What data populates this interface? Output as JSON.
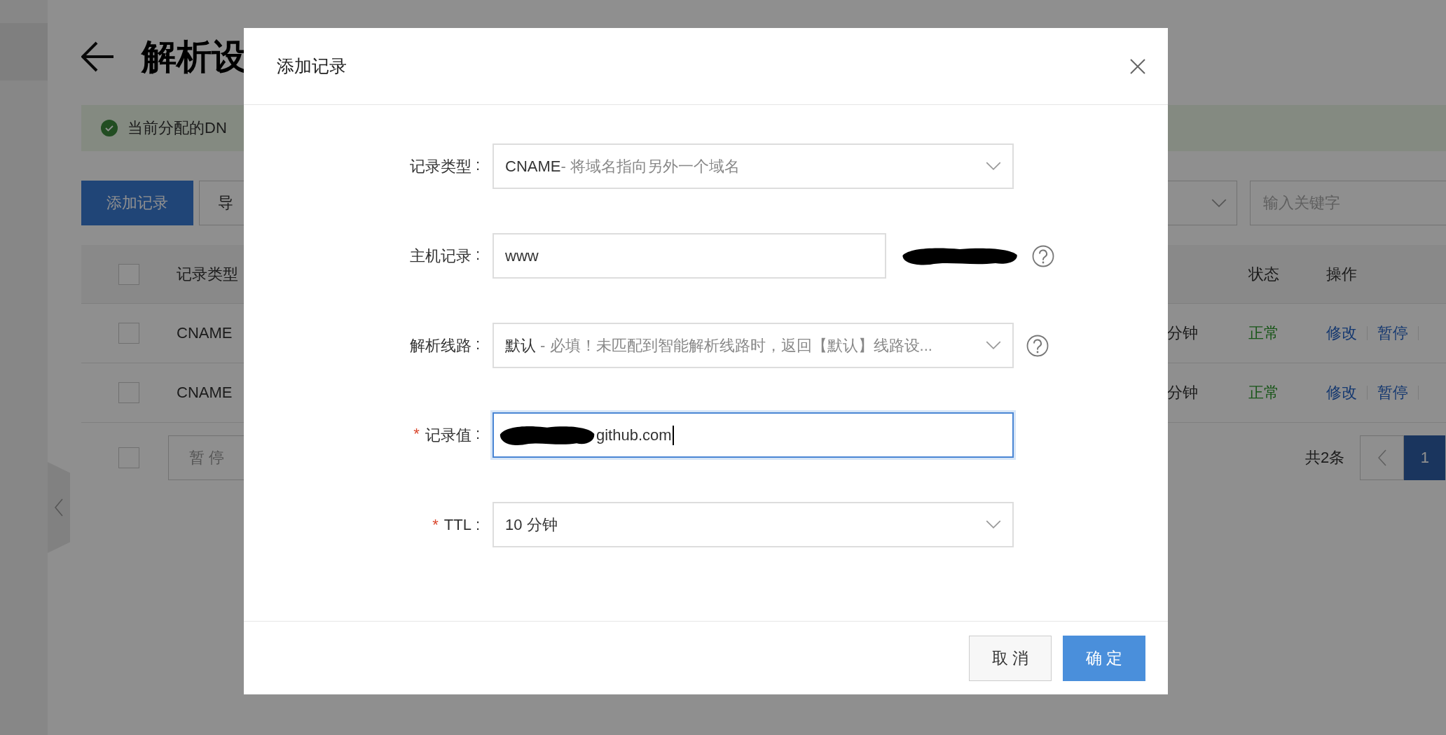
{
  "page": {
    "title": "解析设",
    "alert": "当前分配的DN",
    "toolbar": {
      "buttons": [
        {
          "label": "添加记录",
          "kind": "primary"
        },
        {
          "label": "导",
          "kind": "default"
        }
      ],
      "search": {
        "placeholder": "输入关键字"
      }
    },
    "table": {
      "header_checked": false,
      "columns": [
        {
          "label": "记录类型"
        },
        {
          "label": "状态"
        },
        {
          "label": "操作"
        }
      ],
      "rows": [
        {
          "checked": false,
          "type": "CNAME",
          "ttl": "分钟",
          "status": "正常",
          "actions": [
            "修改",
            "暂停"
          ]
        },
        {
          "checked": false,
          "type": "CNAME",
          "ttl": "分钟",
          "status": "正常",
          "actions": [
            "修改",
            "暂停"
          ]
        }
      ],
      "footer": {
        "checked": false,
        "bulk_button": "暂 停",
        "total": "共2条",
        "pages": [
          {
            "label": "1",
            "selected": true
          }
        ]
      }
    }
  },
  "dialog": {
    "title": "添加记录",
    "fields": [
      {
        "kind": "select",
        "label": "记录类型",
        "colon": ":",
        "value": "CNAME",
        "detail": "- 将域名指向另外一个域名"
      },
      {
        "kind": "text",
        "label": "主机记录",
        "colon": ":",
        "value": "www",
        "suffix_redacted": true,
        "help": true
      },
      {
        "kind": "select",
        "label": "解析线路",
        "colon": ":",
        "value": "默认",
        "detail": " - 必填！未匹配到智能解析线路时，返回【默认】线路设...",
        "help": true
      },
      {
        "kind": "text",
        "label": "记录值",
        "colon": ":",
        "required_mark": "*",
        "value": "github.com",
        "value_redacted": true,
        "focused": true
      },
      {
        "kind": "select",
        "label": "TTL",
        "colon": ":",
        "required_mark": "*",
        "value": "10 分钟"
      }
    ],
    "buttons": [
      {
        "label": "取 消",
        "kind": "secondary"
      },
      {
        "label": "确 定",
        "kind": "primary"
      }
    ]
  }
}
